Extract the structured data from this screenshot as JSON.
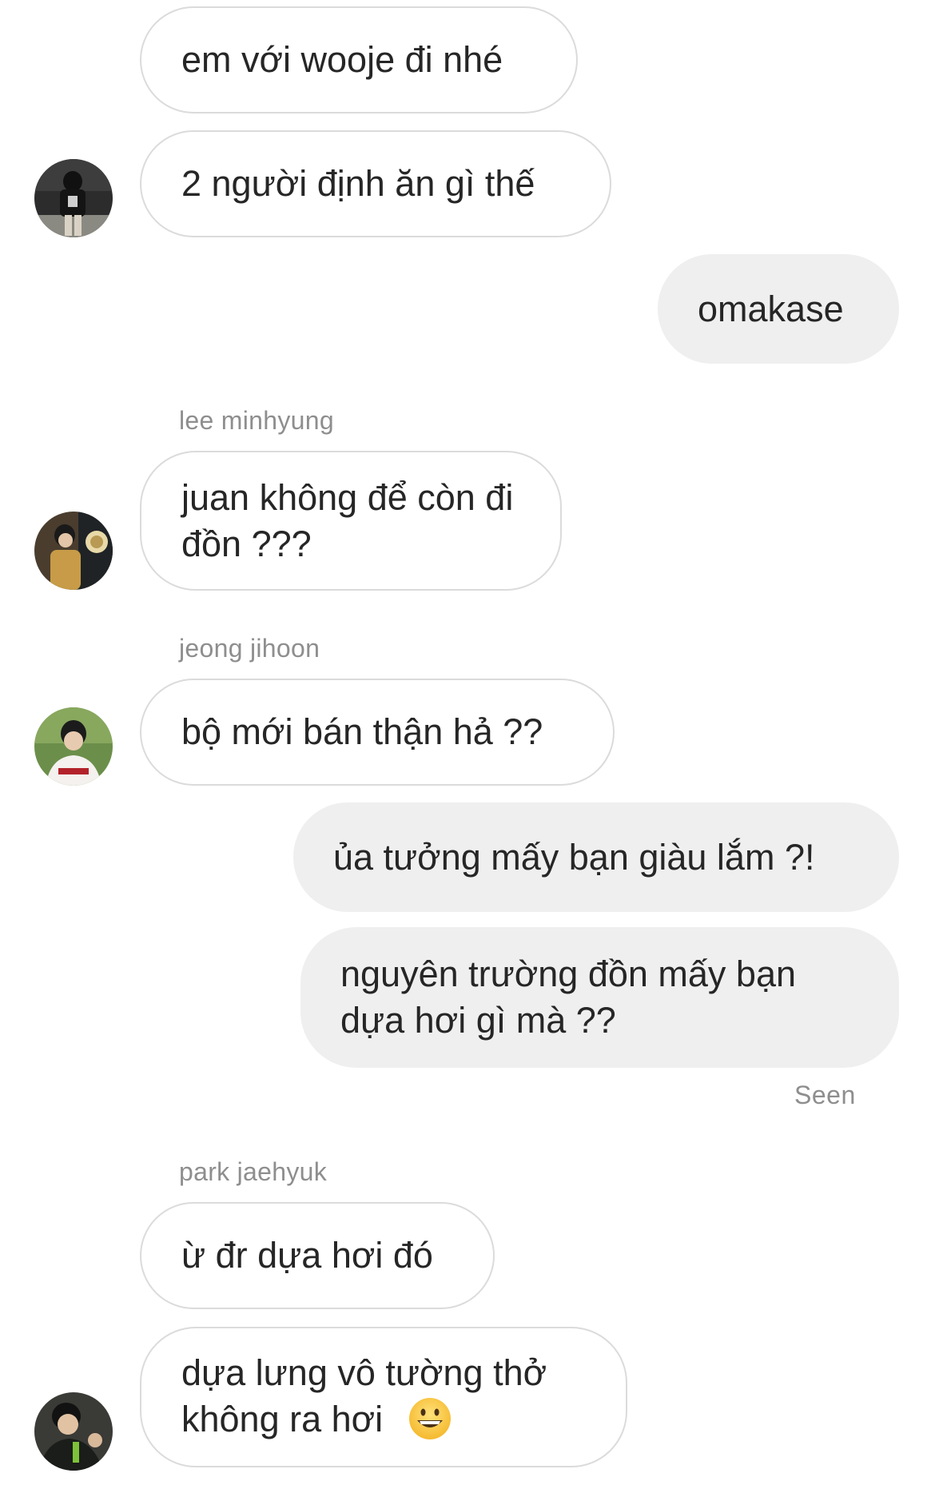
{
  "messages": [
    {
      "text": "em với wooje đi nhé"
    },
    {
      "text": "2 người định ăn gì thế"
    },
    {
      "text": "omakase"
    },
    {
      "sender": "lee minhyung",
      "text": "juan không để còn đi đồn ???"
    },
    {
      "sender": "jeong jihoon",
      "text": "bộ mới bán thận hả ??"
    },
    {
      "text": "ủa tưởng mấy bạn giàu lắm ?!"
    },
    {
      "text": "nguyên trường đồn mấy bạn dựa hơi gì mà ??"
    },
    {
      "sender": "park jaehyuk",
      "text": "ừ đr dựa hơi đó"
    },
    {
      "text": "dựa lưng vô tường thở không ra hơi",
      "emoji": "grinning-face-emoji"
    }
  ],
  "status": {
    "seen": "Seen"
  },
  "colors": {
    "incoming_bubble_border": "#dbdbdb",
    "outgoing_bubble_bg": "#efefef",
    "meta_text": "#8e8e8e",
    "message_text": "#262626"
  }
}
